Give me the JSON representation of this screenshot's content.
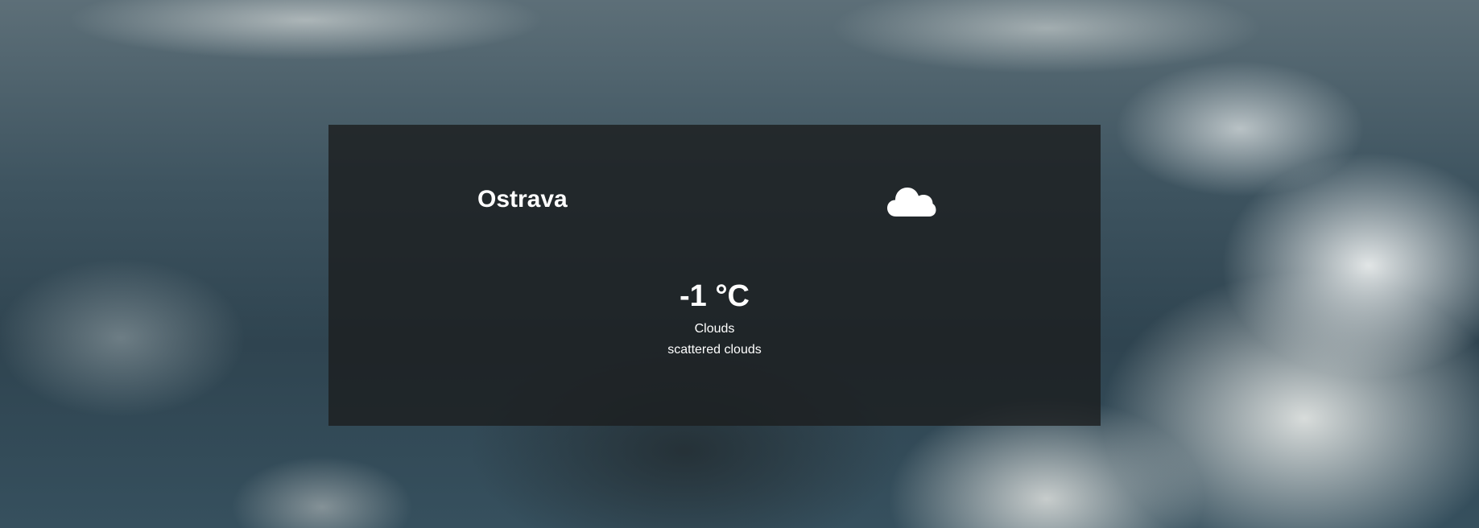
{
  "weather": {
    "city": "Ostrava",
    "icon": "cloud-icon",
    "temperature": "-1 °C",
    "condition": "Clouds",
    "description": "scattered clouds"
  },
  "colors": {
    "panel_background": "#1c1e20",
    "text": "#ffffff",
    "icon": "#ffffff"
  }
}
